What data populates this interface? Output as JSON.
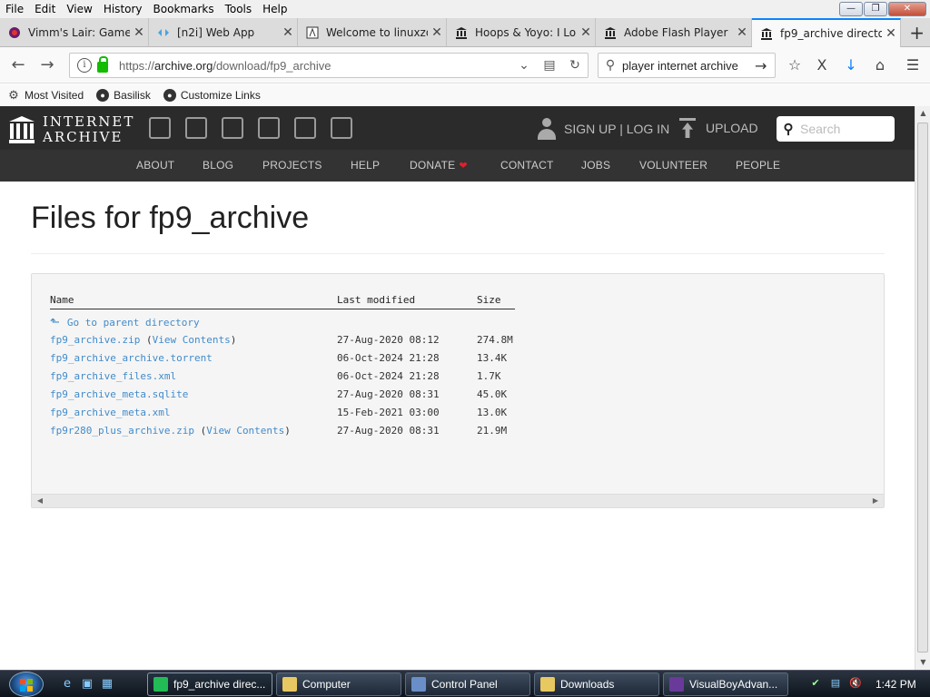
{
  "menu": [
    "File",
    "Edit",
    "View",
    "History",
    "Bookmarks",
    "Tools",
    "Help"
  ],
  "tabs": [
    {
      "title": "Vimm's Lair: Game",
      "icon": "vimm-icon"
    },
    {
      "title": "[n2i] Web App",
      "icon": "n2i-icon"
    },
    {
      "title": "Welcome to linuxzo",
      "icon": "linuxzoo-icon"
    },
    {
      "title": "Hoops & Yoyo: I Lo",
      "icon": "archive-icon"
    },
    {
      "title": "Adobe Flash Player",
      "icon": "archive-icon"
    },
    {
      "title": "fp9_archive directo",
      "icon": "archive-icon"
    }
  ],
  "address": {
    "prefix": "https://",
    "domain": "archive.org",
    "path": "/download/fp9_archive"
  },
  "search": {
    "value": "player internet archive"
  },
  "bookmarks": [
    "Most Visited",
    "Basilisk",
    "Customize Links"
  ],
  "site": {
    "logo_line1": "INTERNET",
    "logo_line2": "ARCHIVE",
    "signup": "SIGN UP | LOG IN",
    "upload": "UPLOAD",
    "search_placeholder": "Search",
    "nav": [
      "ABOUT",
      "BLOG",
      "PROJECTS",
      "HELP",
      "DONATE",
      "CONTACT",
      "JOBS",
      "VOLUNTEER",
      "PEOPLE"
    ]
  },
  "page": {
    "title": "Files for fp9_archive",
    "columns": {
      "name": "Name",
      "modified": "Last modified",
      "size": "Size"
    },
    "parent_link": "Go to parent directory",
    "view_contents": "View Contents",
    "files": [
      {
        "name": "fp9_archive.zip",
        "modified": "27-Aug-2020 08:12",
        "size": "274.8M",
        "view": true
      },
      {
        "name": "fp9_archive_archive.torrent",
        "modified": "06-Oct-2024 21:28",
        "size": "13.4K",
        "view": false
      },
      {
        "name": "fp9_archive_files.xml",
        "modified": "06-Oct-2024 21:28",
        "size": "1.7K",
        "view": false
      },
      {
        "name": "fp9_archive_meta.sqlite",
        "modified": "27-Aug-2020 08:31",
        "size": "45.0K",
        "view": false
      },
      {
        "name": "fp9_archive_meta.xml",
        "modified": "15-Feb-2021 03:00",
        "size": "13.0K",
        "view": false
      },
      {
        "name": "fp9r280_plus_archive.zip",
        "modified": "27-Aug-2020 08:31",
        "size": "21.9M",
        "view": true
      }
    ]
  },
  "taskbar": {
    "buttons": [
      "fp9_archive direc...",
      "Computer",
      "Control Panel",
      "Downloads",
      "VisualBoyAdvan..."
    ],
    "clock": "1:42 PM"
  },
  "colors": {
    "link": "#428bca",
    "ia_header": "#2b2b2b",
    "ia_nav": "#333333",
    "donate_heart": "#e0202c",
    "active_tab_accent": "#0a84ff"
  }
}
